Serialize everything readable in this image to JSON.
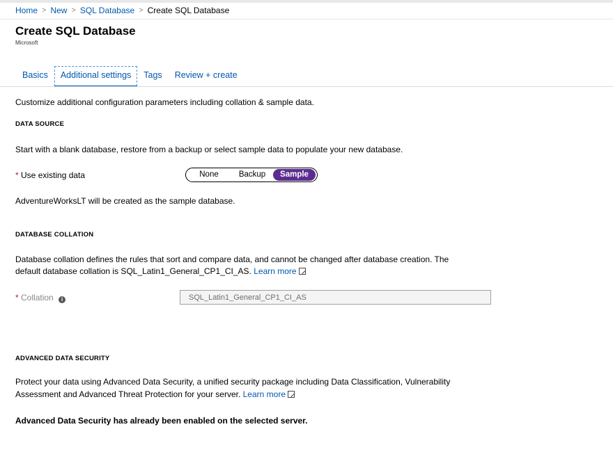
{
  "breadcrumb": {
    "items": [
      "Home",
      "New",
      "SQL Database"
    ],
    "current": "Create SQL Database",
    "separator": ">"
  },
  "page": {
    "title": "Create SQL Database",
    "subtitle": "Microsoft"
  },
  "tabs": [
    {
      "label": "Basics",
      "active": false
    },
    {
      "label": "Additional settings",
      "active": true
    },
    {
      "label": "Tags",
      "active": false
    },
    {
      "label": "Review + create",
      "active": false
    }
  ],
  "intro": "Customize additional configuration parameters including collation & sample data.",
  "data_source": {
    "heading": "DATA SOURCE",
    "description": "Start with a blank database, restore from a backup or select sample data to populate your new database.",
    "required_mark": "*",
    "label": "Use existing data",
    "options": [
      "None",
      "Backup",
      "Sample"
    ],
    "selected": "Sample",
    "note": "AdventureWorksLT will be created as the sample database."
  },
  "collation": {
    "heading": "DATABASE COLLATION",
    "description_line1": "Database collation defines the rules that sort and compare data, and cannot be changed after database creation. The",
    "description_line2": "default database collation is SQL_Latin1_General_CP1_CI_AS.",
    "learn_more": "Learn more",
    "required_mark": "*",
    "label": "Collation",
    "info_icon": "i",
    "value": "SQL_Latin1_General_CP1_CI_AS"
  },
  "security": {
    "heading": "ADVANCED DATA SECURITY",
    "description_line1": "Protect your data using Advanced Data Security, a unified security package including Data Classification, Vulnerability",
    "description_line2": "Assessment and Advanced Threat Protection for your server.",
    "learn_more": "Learn more",
    "status": "Advanced Data Security has already been enabled on the selected server."
  },
  "colors": {
    "link": "#0058ad",
    "accent_purple": "#5c2d91",
    "required_red": "#a4262c"
  }
}
